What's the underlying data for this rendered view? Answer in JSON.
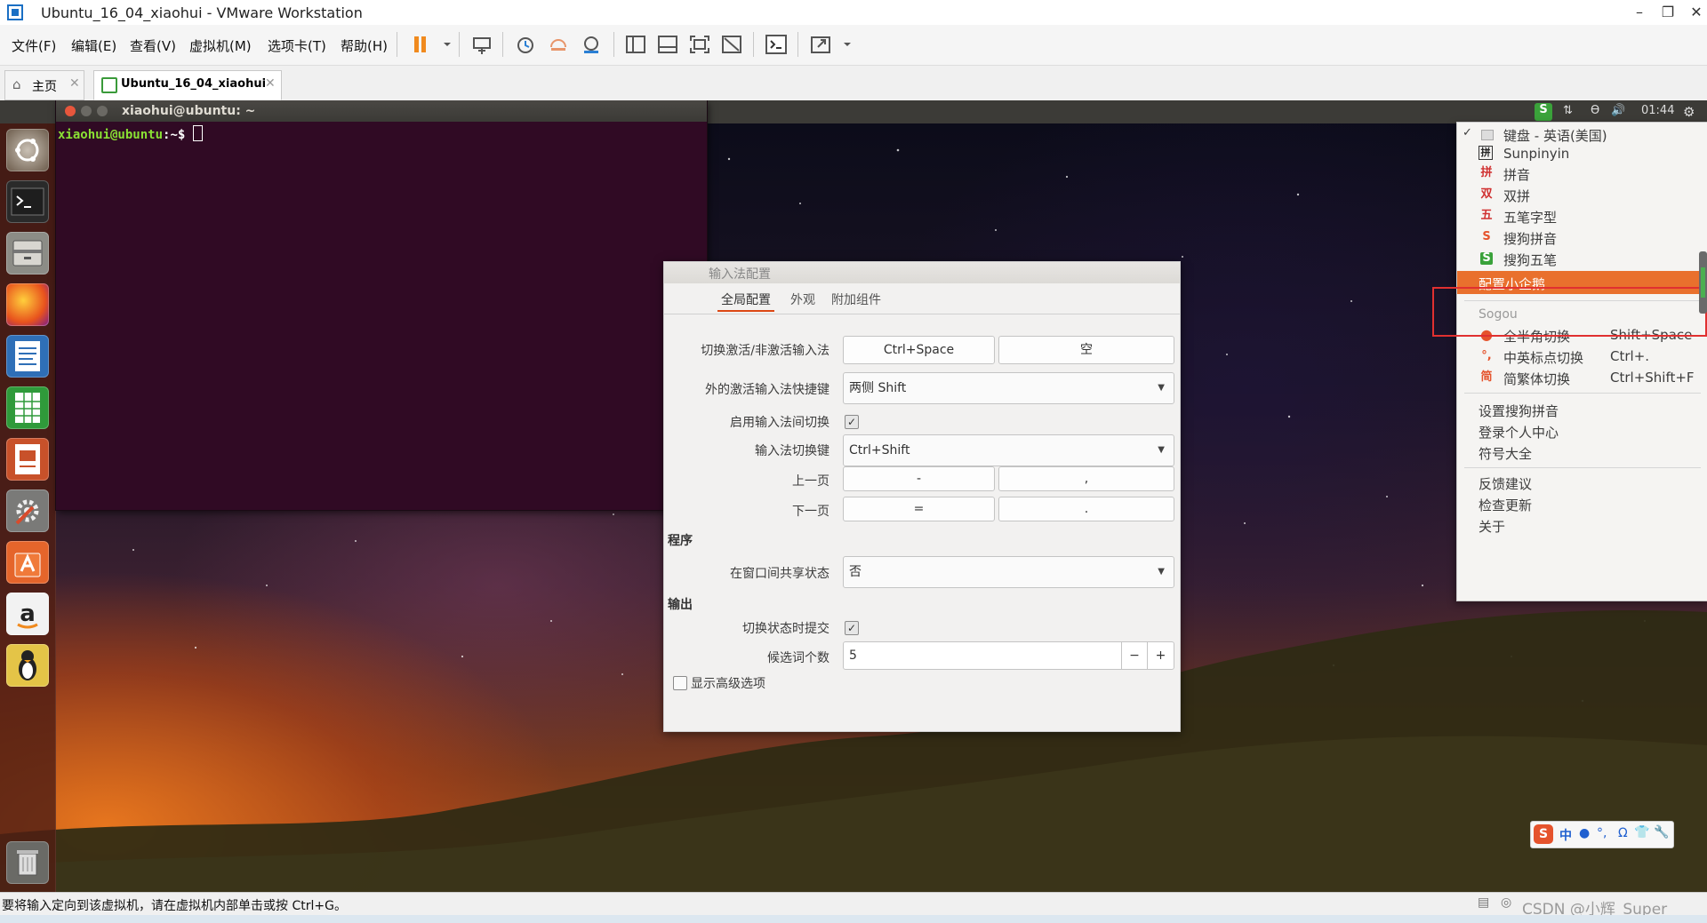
{
  "host": {
    "window_title": "Ubuntu_16_04_xiaohui - VMware Workstation",
    "menu": [
      "文件(F)",
      "编辑(E)",
      "查看(V)",
      "虚拟机(M)",
      "选项卡(T)",
      "帮助(H)"
    ],
    "tabs": [
      {
        "label": "主页",
        "icon": "home-icon"
      },
      {
        "label": "Ubuntu_16_04_xiaohui",
        "icon": "vm-icon"
      }
    ],
    "status_text": "要将输入定向到该虚拟机，请在虚拟机内部单击或按 Ctrl+G。",
    "watermark": "CSDN @小辉_Super"
  },
  "guest": {
    "clock": "01:44",
    "launcher_apps": [
      "ubuntu-dash",
      "terminal",
      "files",
      "firefox",
      "libreoffice-writer",
      "libreoffice-calc",
      "libreoffice-impress",
      "system-settings",
      "ubuntu-software",
      "amazon",
      "tux",
      "trash"
    ],
    "terminal": {
      "title": "xiaohui@ubuntu: ~",
      "prompt_user": "xiaohui@ubuntu",
      "prompt_rest": ":~$ "
    },
    "ime_config": {
      "title": "输入法配置",
      "tabs": [
        "全局配置",
        "外观",
        "附加组件"
      ],
      "rows": {
        "activate_label": "切换激活/非激活输入法",
        "activate_keys": [
          "Ctrl+Space",
          "空"
        ],
        "extra_label": "外的激活输入法快捷键",
        "extra_value": "两侧 Shift",
        "enable_switch_label": "启用输入法间切换",
        "switch_key_label": "输入法切换键",
        "switch_key_value": "Ctrl+Shift",
        "prev_page_label": "上一页",
        "prev_page_keys": [
          "-",
          ","
        ],
        "next_page_label": "下一页",
        "next_page_keys": [
          "=",
          "."
        ],
        "section_program": "程序",
        "share_state_label": "在窗口间共享状态",
        "share_state_value": "否",
        "section_output": "输出",
        "commit_on_switch_label": "切换状态时提交",
        "candidate_count_label": "候选词个数",
        "candidate_count_value": "5",
        "stepper_minus": "−",
        "stepper_plus": "+",
        "show_advanced_label": "显示高级选项"
      }
    },
    "ime_menu": {
      "items_top": [
        {
          "icon": "keyboard-icon",
          "label": "键盘 - 英语(美国)",
          "checked": true
        },
        {
          "icon": "sunpinyin-icon",
          "label": "Sunpinyin",
          "glyph": "拼"
        },
        {
          "icon": "pinyin-icon",
          "label": "拼音",
          "glyph": "拼"
        },
        {
          "icon": "shuangpin-icon",
          "label": "双拼",
          "glyph": "双"
        },
        {
          "icon": "wubi-icon",
          "label": "五笔字型",
          "glyph": "五"
        },
        {
          "icon": "sogou-pinyin-icon",
          "label": "搜狗拼音",
          "glyph": "S"
        },
        {
          "icon": "sogou-wubi-icon",
          "label": "搜狗五笔",
          "glyph": "S"
        }
      ],
      "highlighted": "配置小企鹅",
      "section_sogou": "Sogou",
      "sogou_items": [
        {
          "label": "全半角切换",
          "shortcut": "Shift+Space",
          "glyph": "●"
        },
        {
          "label": "中英标点切换",
          "shortcut": "Ctrl+.",
          "glyph": "°,"
        },
        {
          "label": "简繁体切换",
          "shortcut": "Ctrl+Shift+F",
          "glyph": "简"
        }
      ],
      "group2": [
        "设置搜狗拼音",
        "登录个人中心",
        "符号大全"
      ],
      "group3": [
        "反馈建议",
        "检查更新",
        "关于"
      ]
    },
    "sogou_status_bar": [
      "中",
      "●",
      "°,",
      "Ω",
      "👕",
      "🔧"
    ],
    "colors": {
      "highlight": "#e9702d",
      "annotation_box": "#e03030",
      "terminal_bg": "#300a24",
      "prompt_green": "#8ae234"
    }
  }
}
